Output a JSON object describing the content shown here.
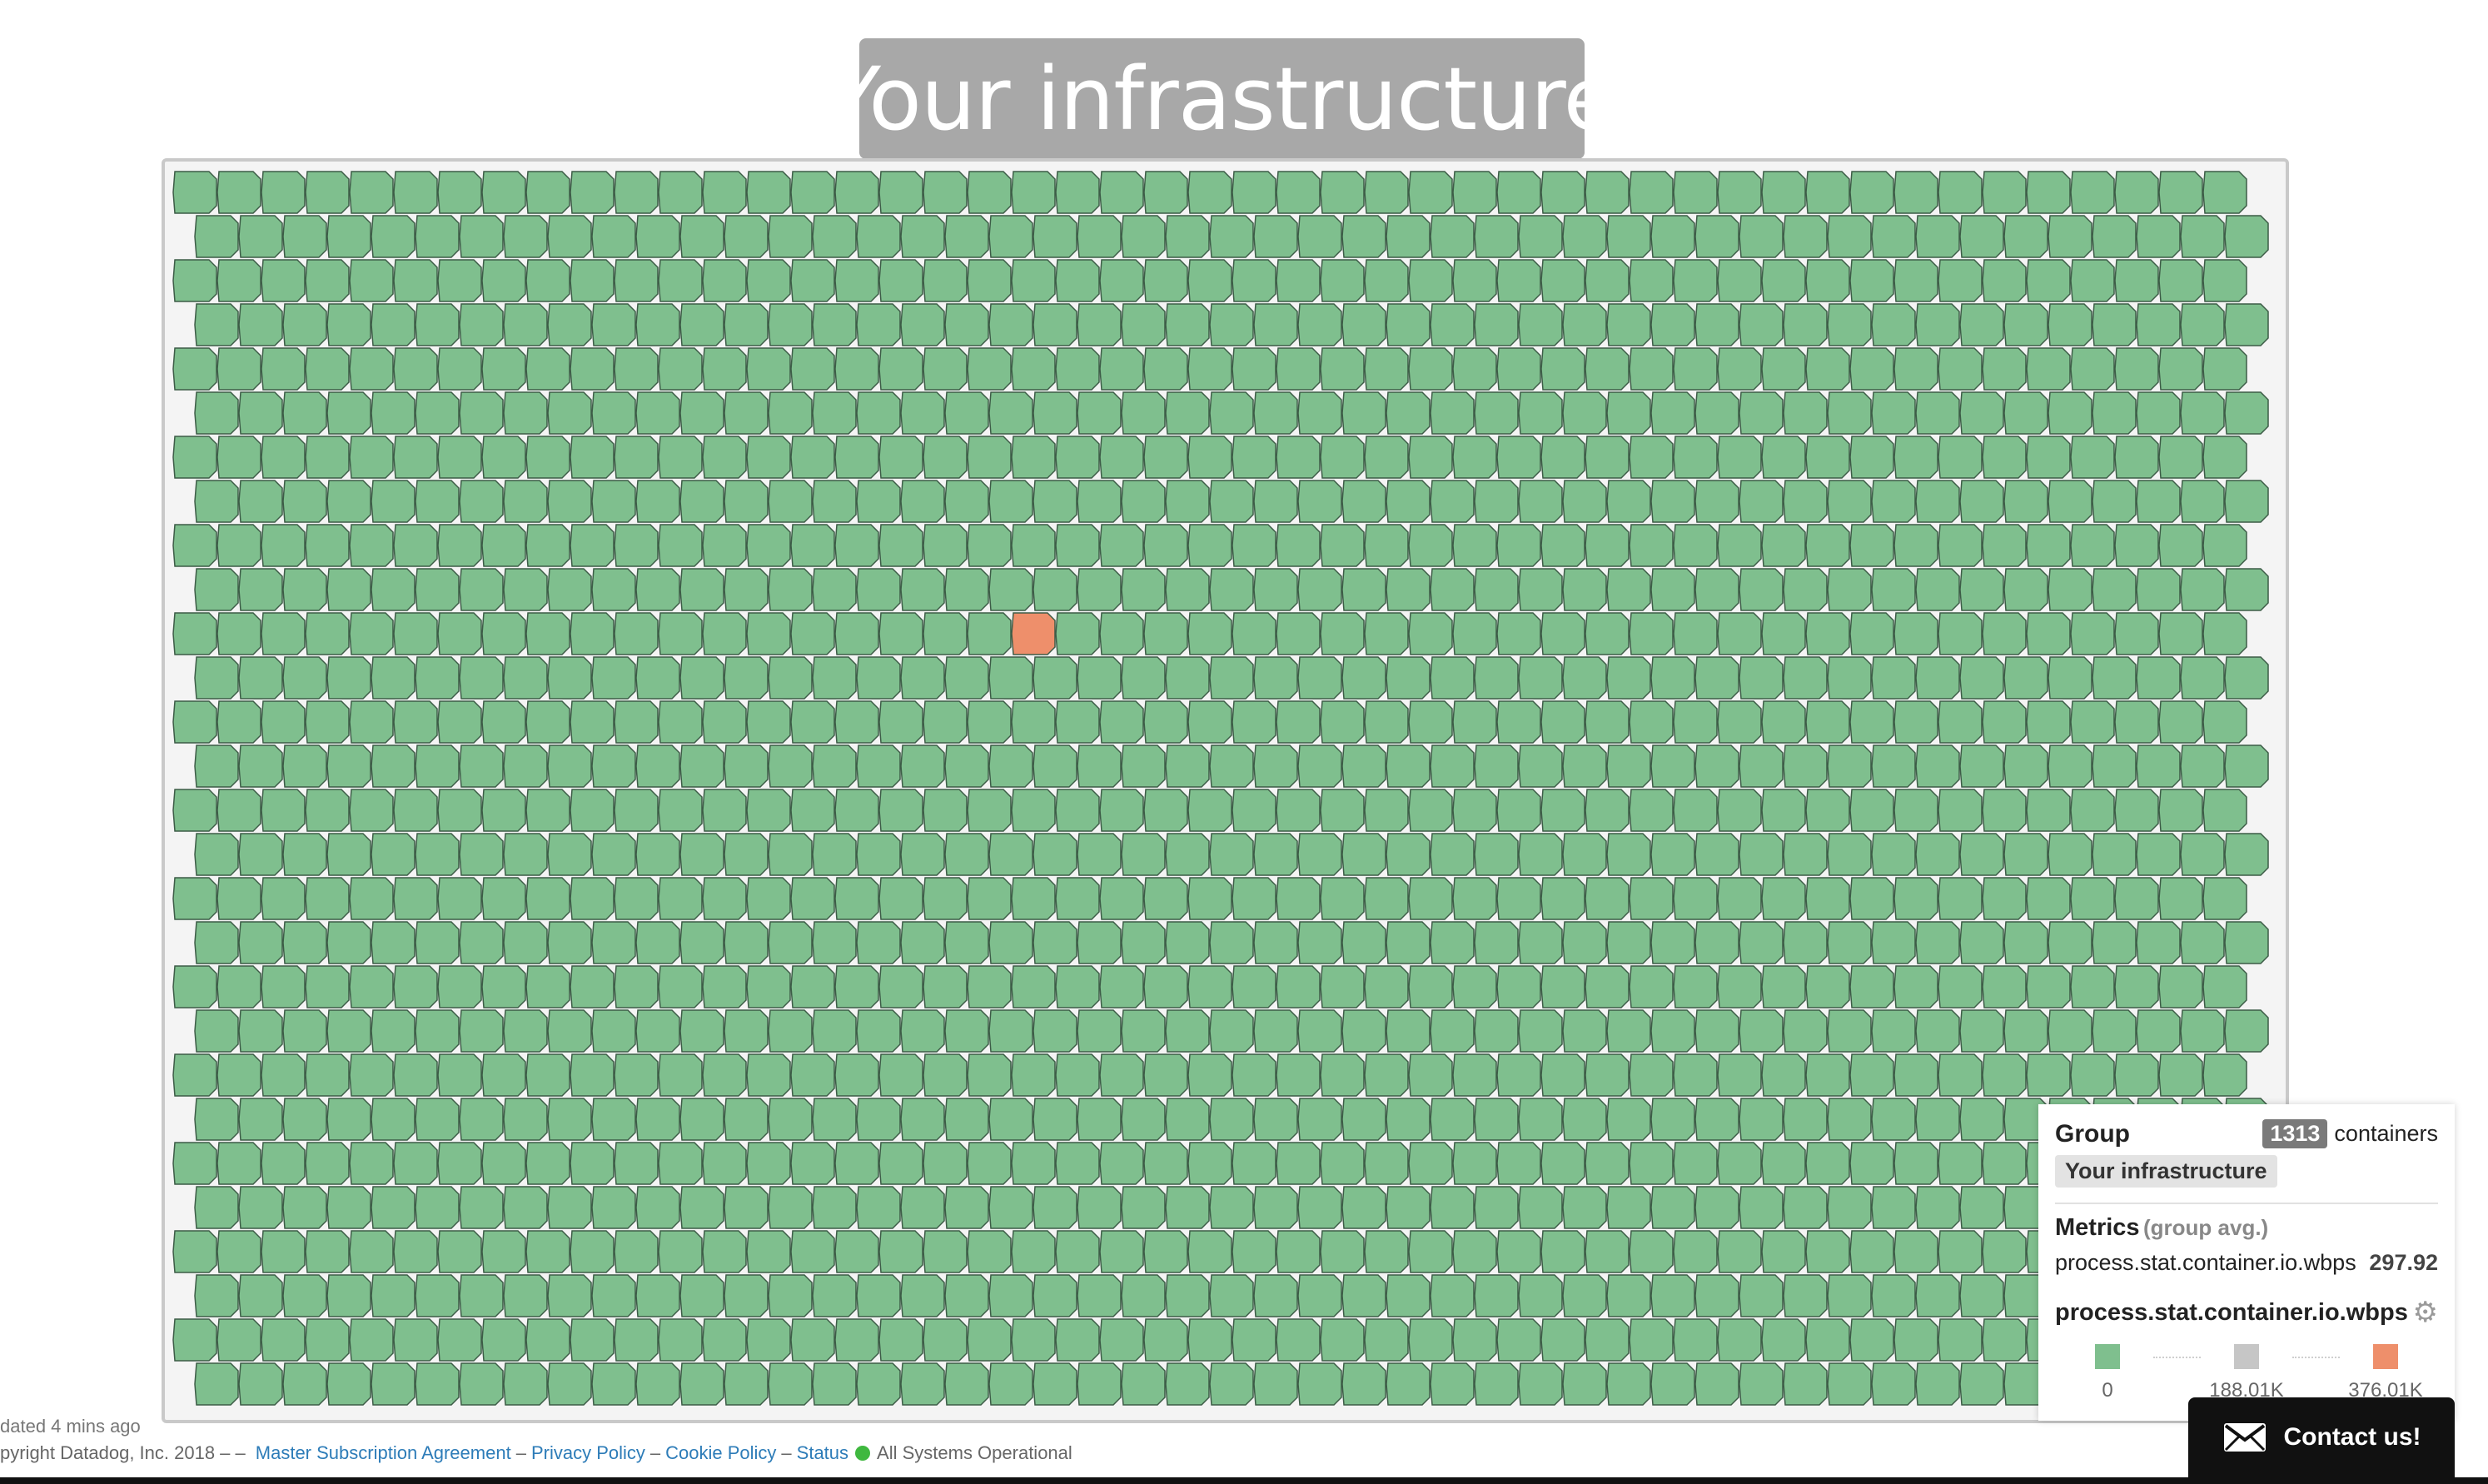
{
  "title": "Your infrastructure",
  "hostmap": {
    "cell_color": "#7fbf8e",
    "hot_cell_color": "#ee8f6b",
    "hot_cell": {
      "row": 10,
      "col": 19
    }
  },
  "group_panel": {
    "heading": "Group",
    "count": "1313",
    "count_unit": "containers",
    "group_tag": "Your infrastructure",
    "metrics_heading": "Metrics",
    "metrics_sub": "(group avg.)",
    "metric_name": "process.stat.container.io.wbps",
    "metric_value": "297.92",
    "legend_title": "process.stat.container.io.wbps",
    "gear_icon": "gear-icon",
    "scale": [
      {
        "label": "0",
        "color": "#7fbf8e"
      },
      {
        "label": "188.01K",
        "color": "#c6c6c6"
      },
      {
        "label": "376.01K",
        "color": "#ee8f6b"
      }
    ]
  },
  "updated_text": "dated 4 mins ago",
  "footer": {
    "copyright": "pyright Datadog, Inc. 2018 – –",
    "links": [
      "Master Subscription Agreement",
      "Privacy Policy",
      "Cookie Policy",
      "Status"
    ],
    "separator": "–",
    "status_text": "All Systems Operational",
    "status_color": "#3fb83f"
  },
  "contact_button": {
    "label": "Contact us!",
    "icon": "mail-icon"
  }
}
